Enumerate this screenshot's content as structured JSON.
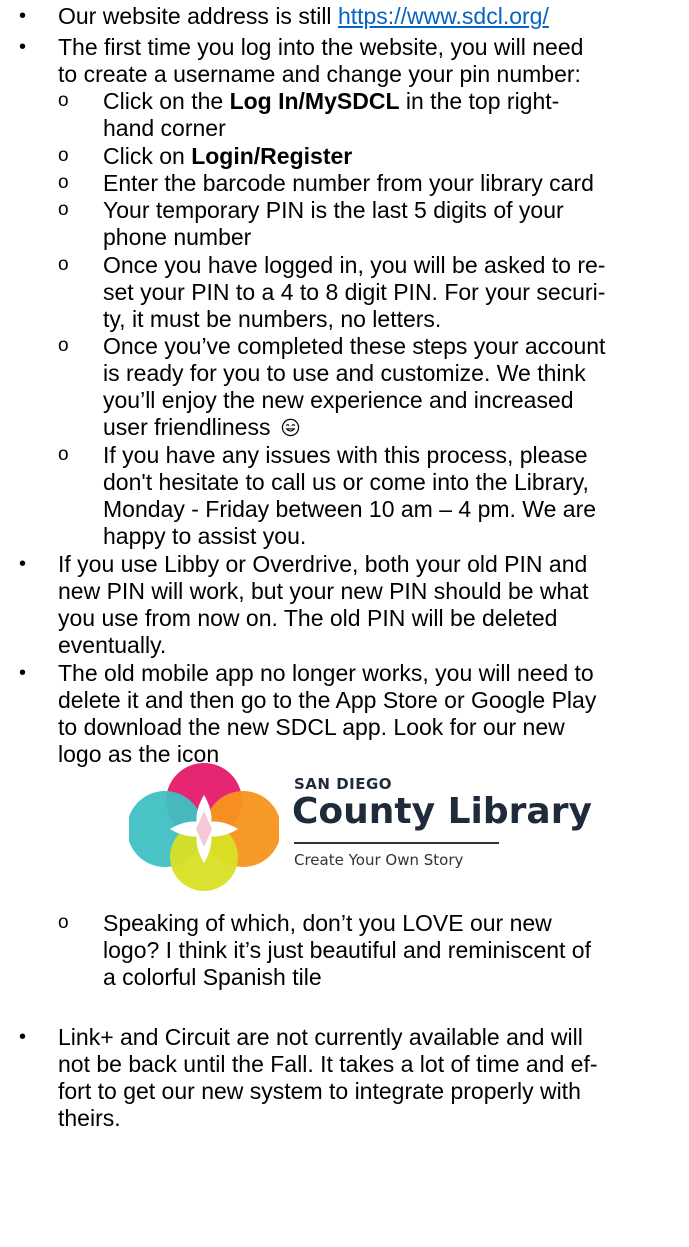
{
  "lines": {
    "l0": "Our website address is still",
    "l0_link": "https://www.sdcl.org/",
    "l1": "The first time you log into the website, you will need",
    "l2": "to create a username and change your pin number:",
    "l3a": "Click on the",
    "l3b": "Log In/MySDCL",
    "l3c": "in the top right-",
    "l4": "hand corner",
    "l5a": "Click on",
    "l5b": "Login/Register",
    "l6": "Enter the barcode number from your library card",
    "l7": "Your temporary PIN is the last 5 digits of your",
    "l8": "phone number",
    "l9": "Once you have logged in, you will be asked to re-",
    "l10": "set your PIN to a 4 to 8 digit PIN. For your securi-",
    "l11": "ty, it must be numbers, no letters.",
    "l12": "Once you’ve completed these steps your account",
    "l13": "is ready for you to use and customize. We think",
    "l14": "you’ll enjoy the new experience and increased",
    "l15": "user friendliness",
    "l16": "If you have any issues with this process, please",
    "l17": "don't hesitate to call us or come into the Library,",
    "l18": "Monday - Friday between 10 am – 4 pm.  We are",
    "l19": "happy to assist you.",
    "l20": "If you use Libby or Overdrive, both your old PIN and",
    "l21": "new PIN will work, but your new PIN should be what",
    "l22": "you use from now on. The old PIN will be deleted",
    "l23": "eventually.",
    "l24": "The old mobile app no longer works, you will need to",
    "l25": "delete it and then go to the App Store or Google Play",
    "l26": "to download the new SDCL app.  Look for our new",
    "l27": "logo as the icon",
    "l28": "Speaking of which, don’t you LOVE our new",
    "l29": "logo?  I think it’s just beautiful and reminiscent of",
    "l30": "a colorful Spanish tile",
    "l31": "Link+ and Circuit are not currently available and will",
    "l32": "not be back until the Fall. It takes a lot of time and ef-",
    "l33": "fort to get our new system to integrate properly with",
    "l34": "theirs."
  },
  "logo": {
    "top_text": "SAN DIEGO",
    "main_text": "County Library",
    "tagline": "Create Your Own Story",
    "colors": {
      "pink": "#e5196b",
      "orange": "#f7941d",
      "teal": "#3fc0c3",
      "yellow": "#d9df24",
      "text": "#1f2a3a"
    }
  },
  "link_color": "#0563c1"
}
